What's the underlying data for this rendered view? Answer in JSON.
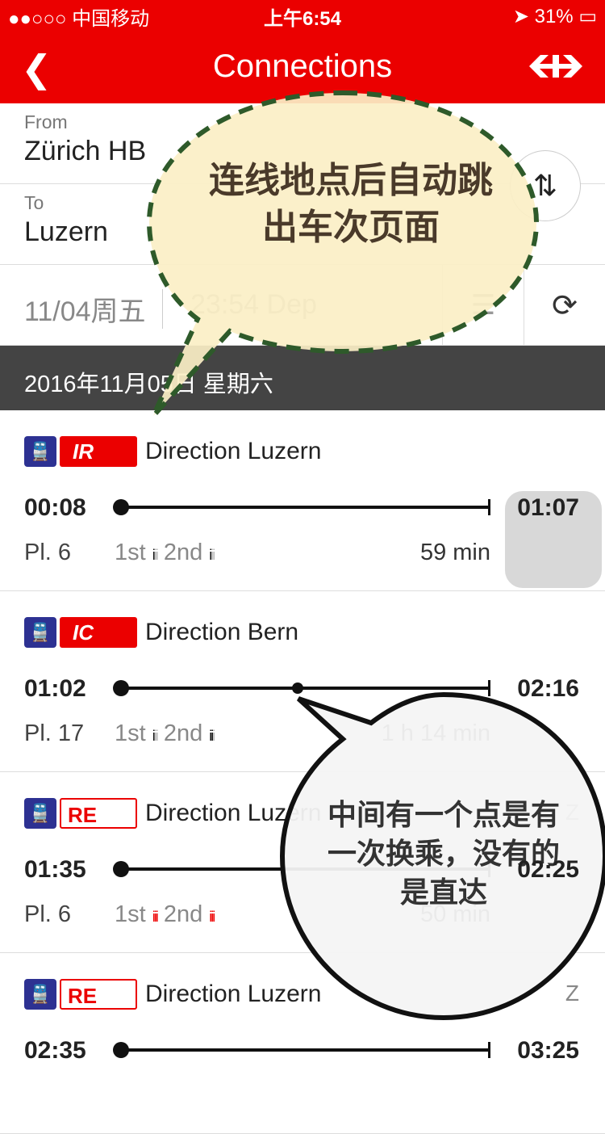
{
  "status_bar": {
    "carrier": "●●○○○ 中国移动",
    "time": "上午6:54",
    "battery": "31%"
  },
  "header": {
    "title": "Connections",
    "back_icon": "chevron-left",
    "logo": "sbb-logo"
  },
  "from": {
    "label": "From",
    "value": "Zürich HB"
  },
  "to": {
    "label": "To",
    "value": "Luzern"
  },
  "datetime": {
    "date": "11/04周五",
    "time": "23:54 Dep"
  },
  "section_date": "2016年11月05日 星期六",
  "connections": [
    {
      "category": "IR",
      "direction": "Direction Luzern",
      "dep": "00:08",
      "arr": "01:07",
      "platform": "Pl. 6",
      "first": "1st",
      "second": "2nd",
      "duration": "59 min",
      "transfer": false,
      "occupancy": "low"
    },
    {
      "category": "IC",
      "direction": "Direction Bern",
      "dep": "01:02",
      "arr": "02:16",
      "platform": "Pl. 17",
      "first": "1st",
      "second": "2nd",
      "duration": "1 h 14 min",
      "transfer": true,
      "occupancy": "medium"
    },
    {
      "category": "RE",
      "direction": "Direction Luzern",
      "dep": "01:35",
      "arr": "02:25",
      "platform": "Pl. 6",
      "first": "1st",
      "second": "2nd",
      "duration": "50 min",
      "transfer": false,
      "occupancy": "high",
      "note": "Z"
    },
    {
      "category": "RE",
      "direction": "Direction Luzern",
      "dep": "02:35",
      "arr": "03:25",
      "note": "Z"
    }
  ],
  "annotations": {
    "bubble1": "连线地点后自动跳出车次页面",
    "bubble2": "中间有一个点是有一次换乘，没有的是直达"
  },
  "colors": {
    "brand_red": "#eb0000",
    "train_blue": "#2d3192",
    "section_bg": "#444444",
    "bubble1_fill": "#fbefc6",
    "bubble1_border": "#2e5a2a"
  }
}
